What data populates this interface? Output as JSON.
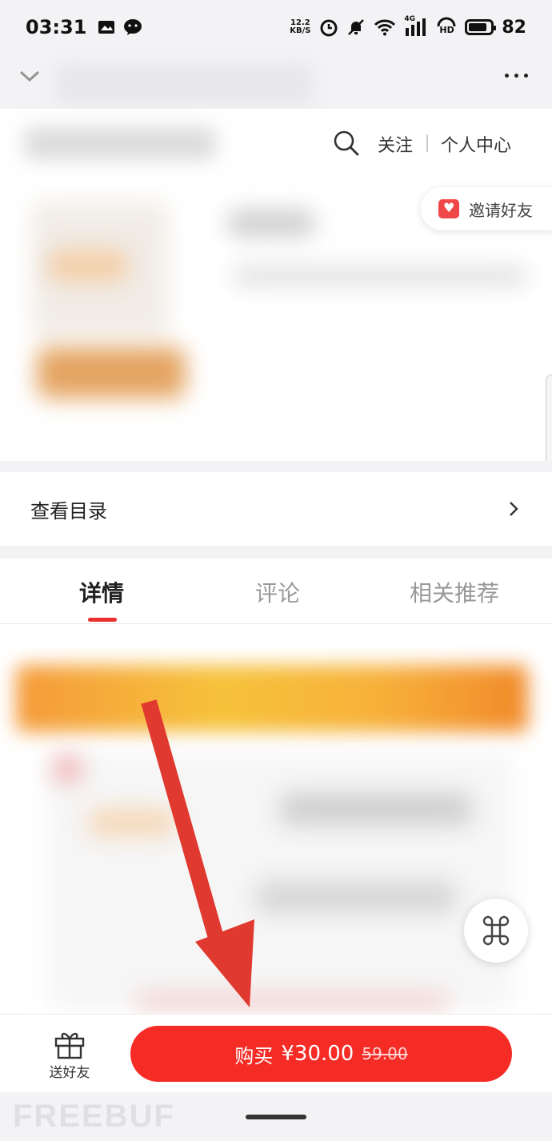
{
  "status_bar": {
    "time": "03:31",
    "net_speed_value": "12.2",
    "net_speed_unit": "KB/S",
    "signal_label": "4G",
    "hd_label": "HD",
    "battery_percent": "82",
    "battery_level": 0.82
  },
  "shop_header": {
    "follow": "关注",
    "profile": "个人中心"
  },
  "invite": {
    "label": "邀请好友"
  },
  "catalog": {
    "label": "查看目录"
  },
  "tabs": [
    {
      "label": "详情",
      "active": true
    },
    {
      "label": "评论",
      "active": false
    },
    {
      "label": "相关推荐",
      "active": false
    }
  ],
  "bottom_bar": {
    "gift_label": "送好友",
    "buy_label": "购买",
    "price": "¥30.00",
    "original_price": "59.00"
  },
  "watermark": "FREEBUF",
  "colors": {
    "accent": "#f52b26",
    "tab_indicator": "#e9302d",
    "arrow": "#e03a30"
  }
}
